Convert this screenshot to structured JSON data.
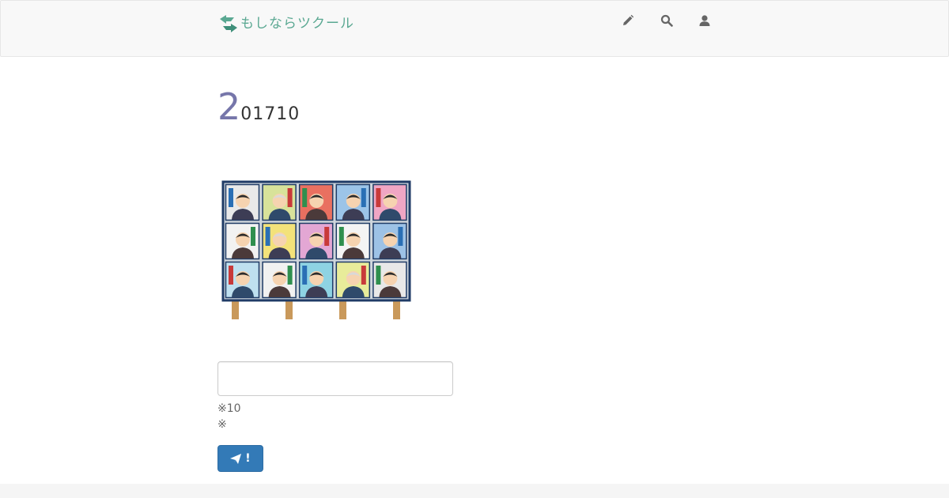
{
  "brand": {
    "name": "もしならツクール",
    "logo_icon": "arrows-logo-icon"
  },
  "nav": {
    "items": [
      {
        "icon": "pencil-icon",
        "name": "edit"
      },
      {
        "icon": "search-icon",
        "name": "search"
      },
      {
        "icon": "user-icon",
        "name": "account"
      }
    ]
  },
  "heading": {
    "first_digit": "2",
    "rest": "01710"
  },
  "image": {
    "subject": "election-poster-board-illustration"
  },
  "form": {
    "input_value": "",
    "note_1": "※10",
    "note_2": "※",
    "submit_label": "!",
    "submit_icon": "paper-plane-icon"
  },
  "colors": {
    "brand_green": "#5aa892",
    "heading_digit": "#7676aa",
    "button_blue": "#337ab7"
  }
}
